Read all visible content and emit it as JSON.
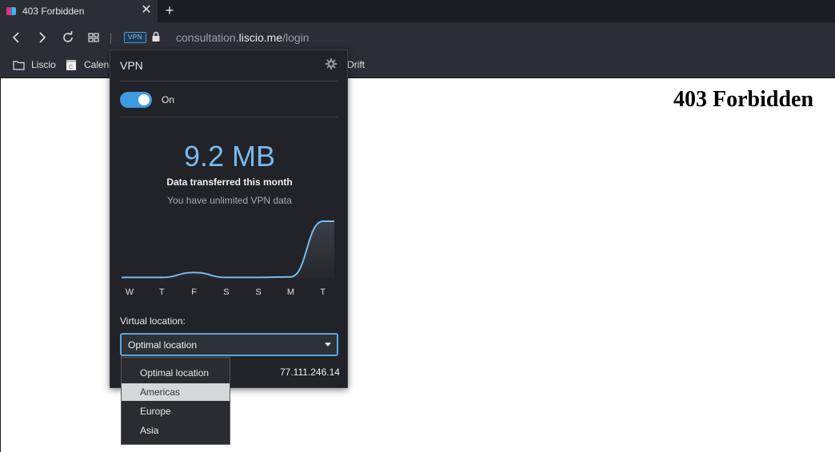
{
  "tab": {
    "title": "403 Forbidden",
    "close": "✕",
    "new_tab": "+"
  },
  "toolbar": {
    "vpn_badge": "VPN",
    "url_prefix": "consultation.",
    "url_host": "liscio.me",
    "url_path": "/login"
  },
  "bookmarks": [
    {
      "label": "Liscio"
    },
    {
      "label": "Calend"
    },
    {
      "label": "Drift"
    }
  ],
  "page": {
    "heading": "403 Forbidden"
  },
  "vpn_popup": {
    "title": "VPN",
    "toggle_label": "On",
    "toggle_on": true,
    "data_amount": "9.2 MB",
    "data_caption": "Data transferred this month",
    "data_note": "You have unlimited VPN data",
    "virtual_location_label": "Virtual location:",
    "selected_location": "Optimal location",
    "ip_address": "77.111.246.14",
    "accent_color": "#3d9be0",
    "location_options": [
      "Optimal location",
      "Americas",
      "Europe",
      "Asia"
    ],
    "highlighted_option": "Americas"
  },
  "chart_data": {
    "type": "area",
    "categories": [
      "W",
      "T",
      "F",
      "S",
      "S",
      "M",
      "T"
    ],
    "values": [
      0.2,
      0.2,
      1.0,
      0.2,
      0.2,
      0.3,
      9.2
    ],
    "ylim": [
      0,
      9.2
    ],
    "grid": false
  }
}
